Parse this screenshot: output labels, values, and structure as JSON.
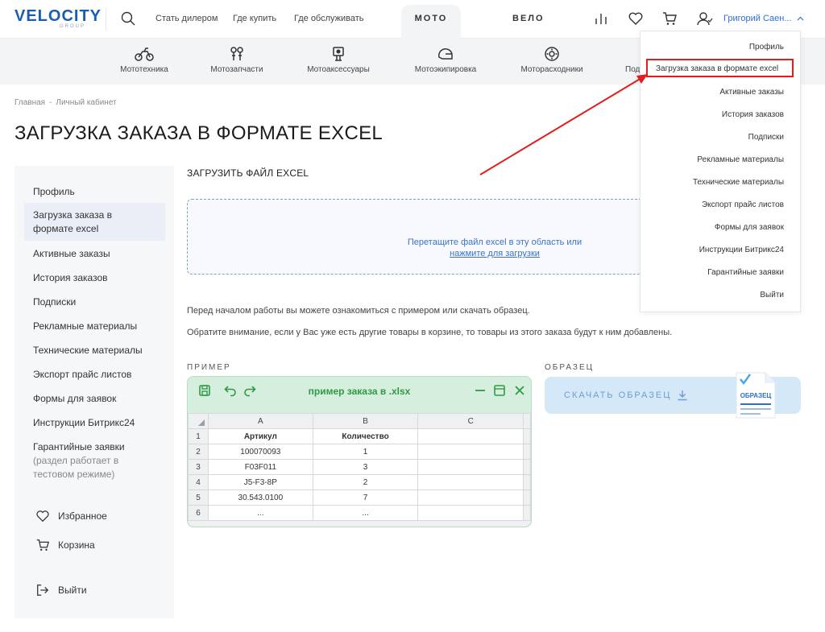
{
  "header": {
    "logo_main": "VELOCITY",
    "logo_sub": "GROUP",
    "links": [
      "Стать дилером",
      "Где купить",
      "Где обслуживать"
    ],
    "tab_moto": "МОТО",
    "tab_velo": "ВЕЛО",
    "user_name": "Григорий Саен..."
  },
  "categories": [
    "Мототехника",
    "Мотозапчасти",
    "Мотоаксессуары",
    "Мотоэкипировка",
    "Моторасходники",
    "Под"
  ],
  "breadcrumbs": [
    "Главная",
    "Личный кабинет"
  ],
  "page_title": "ЗАГРУЗКА ЗАКАЗА В ФОРМАТЕ EXCEL",
  "sidebar": {
    "items": [
      {
        "label": "Профиль"
      },
      {
        "label": "Загрузка заказа в формате excel"
      },
      {
        "label": "Активные заказы"
      },
      {
        "label": "История заказов"
      },
      {
        "label": "Подписки"
      },
      {
        "label": "Рекламные материалы"
      },
      {
        "label": "Технические материалы"
      },
      {
        "label": "Экспорт прайс листов"
      },
      {
        "label": "Формы для заявок"
      },
      {
        "label": "Инструкции Битрикс24"
      },
      {
        "label": "Гарантийные заявки",
        "note": "(раздел работает в тестовом режиме)"
      }
    ],
    "favorites": "Избранное",
    "cart": "Корзина",
    "logout": "Выйти"
  },
  "main": {
    "upload_heading": "ЗАГРУЗИТЬ ФАЙЛ EXCEL",
    "drop_text": "Перетащите файл excel в эту область или",
    "drop_link": "нажмите для загрузки",
    "note1": "Перед началом работы вы можете ознакомиться с примером или скачать образец.",
    "note2": "Обратите внимание, если у Вас уже есть другие товары в корзине, то товары из этого заказа будут к ним добавлены.",
    "example_label": "ПРИМЕР",
    "sample_label": "ОБРАЗЕЦ",
    "download_button": "СКАЧАТЬ ОБРАЗЕЦ",
    "sample_doc_label": "ОБРАЗЕЦ"
  },
  "excel": {
    "title": "пример заказа в .xlsx",
    "columns": [
      "A",
      "B",
      "C"
    ],
    "rows": [
      {
        "n": "1",
        "a": "Артикул",
        "b": "Количество",
        "c": ""
      },
      {
        "n": "2",
        "a": "100070093",
        "b": "1",
        "c": ""
      },
      {
        "n": "3",
        "a": "F03F011",
        "b": "3",
        "c": ""
      },
      {
        "n": "4",
        "a": "J5-F3-8P",
        "b": "2",
        "c": ""
      },
      {
        "n": "5",
        "a": "30.543.0100",
        "b": "7",
        "c": ""
      },
      {
        "n": "6",
        "a": "...",
        "b": "...",
        "c": ""
      }
    ]
  },
  "dropdown": {
    "items": [
      "Профиль",
      "Загрузка заказа в формате excel",
      "Активные заказы",
      "История заказов",
      "Подписки",
      "Рекламные материалы",
      "Технические материалы",
      "Экспорт прайс листов",
      "Формы для заявок",
      "Инструкции Битрикс24",
      "Гарантийные заявки",
      "Выйти"
    ]
  },
  "colors": {
    "accent": "#2f6fd0",
    "excel_green": "#2f9a46",
    "highlight_red": "#e11d1d"
  }
}
